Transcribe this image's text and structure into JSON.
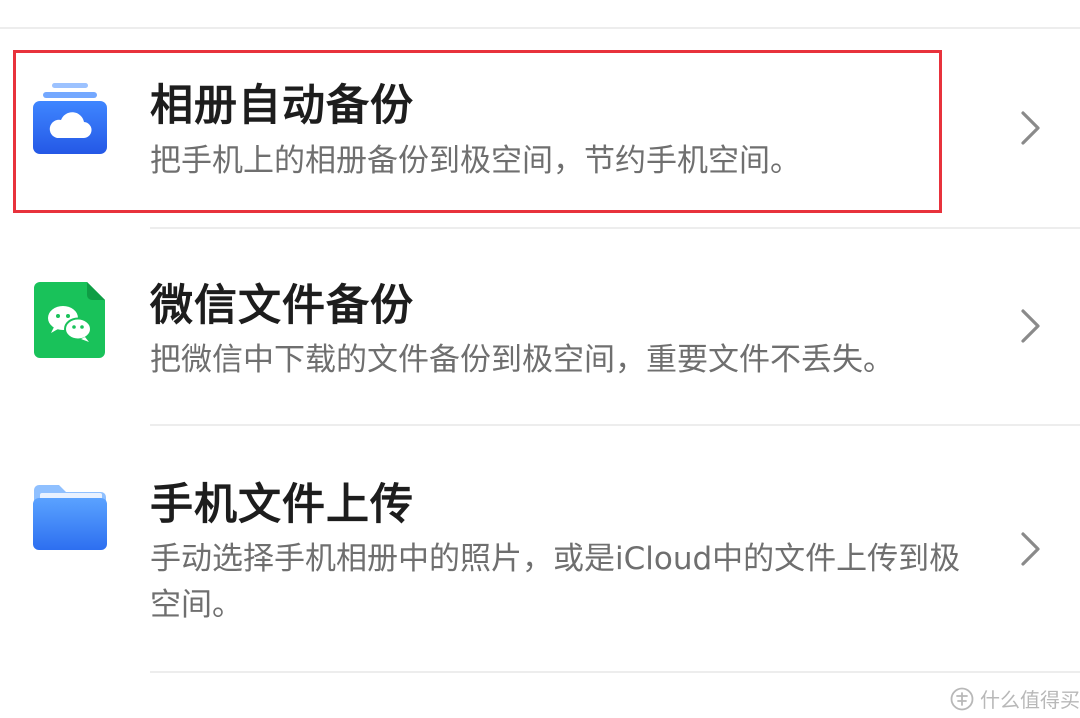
{
  "items": [
    {
      "title": "相册自动备份",
      "description": "把手机上的相册备份到极空间，节约手机空间。",
      "icon": "cloud-album-icon",
      "highlighted": true
    },
    {
      "title": "微信文件备份",
      "description": "把微信中下载的文件备份到极空间，重要文件不丢失。",
      "icon": "wechat-file-icon",
      "highlighted": false
    },
    {
      "title": "手机文件上传",
      "description": "手动选择手机相册中的照片，或是iCloud中的文件上传到极空间。",
      "icon": "folder-icon",
      "highlighted": false
    }
  ],
  "watermark": {
    "text": "什么值得买",
    "icon": "zhi-logo-icon"
  },
  "colors": {
    "highlight": "#e8323c",
    "album_blue": "#2f6ef0",
    "wechat_green": "#19c25a",
    "folder_blue": "#3a86f2"
  }
}
